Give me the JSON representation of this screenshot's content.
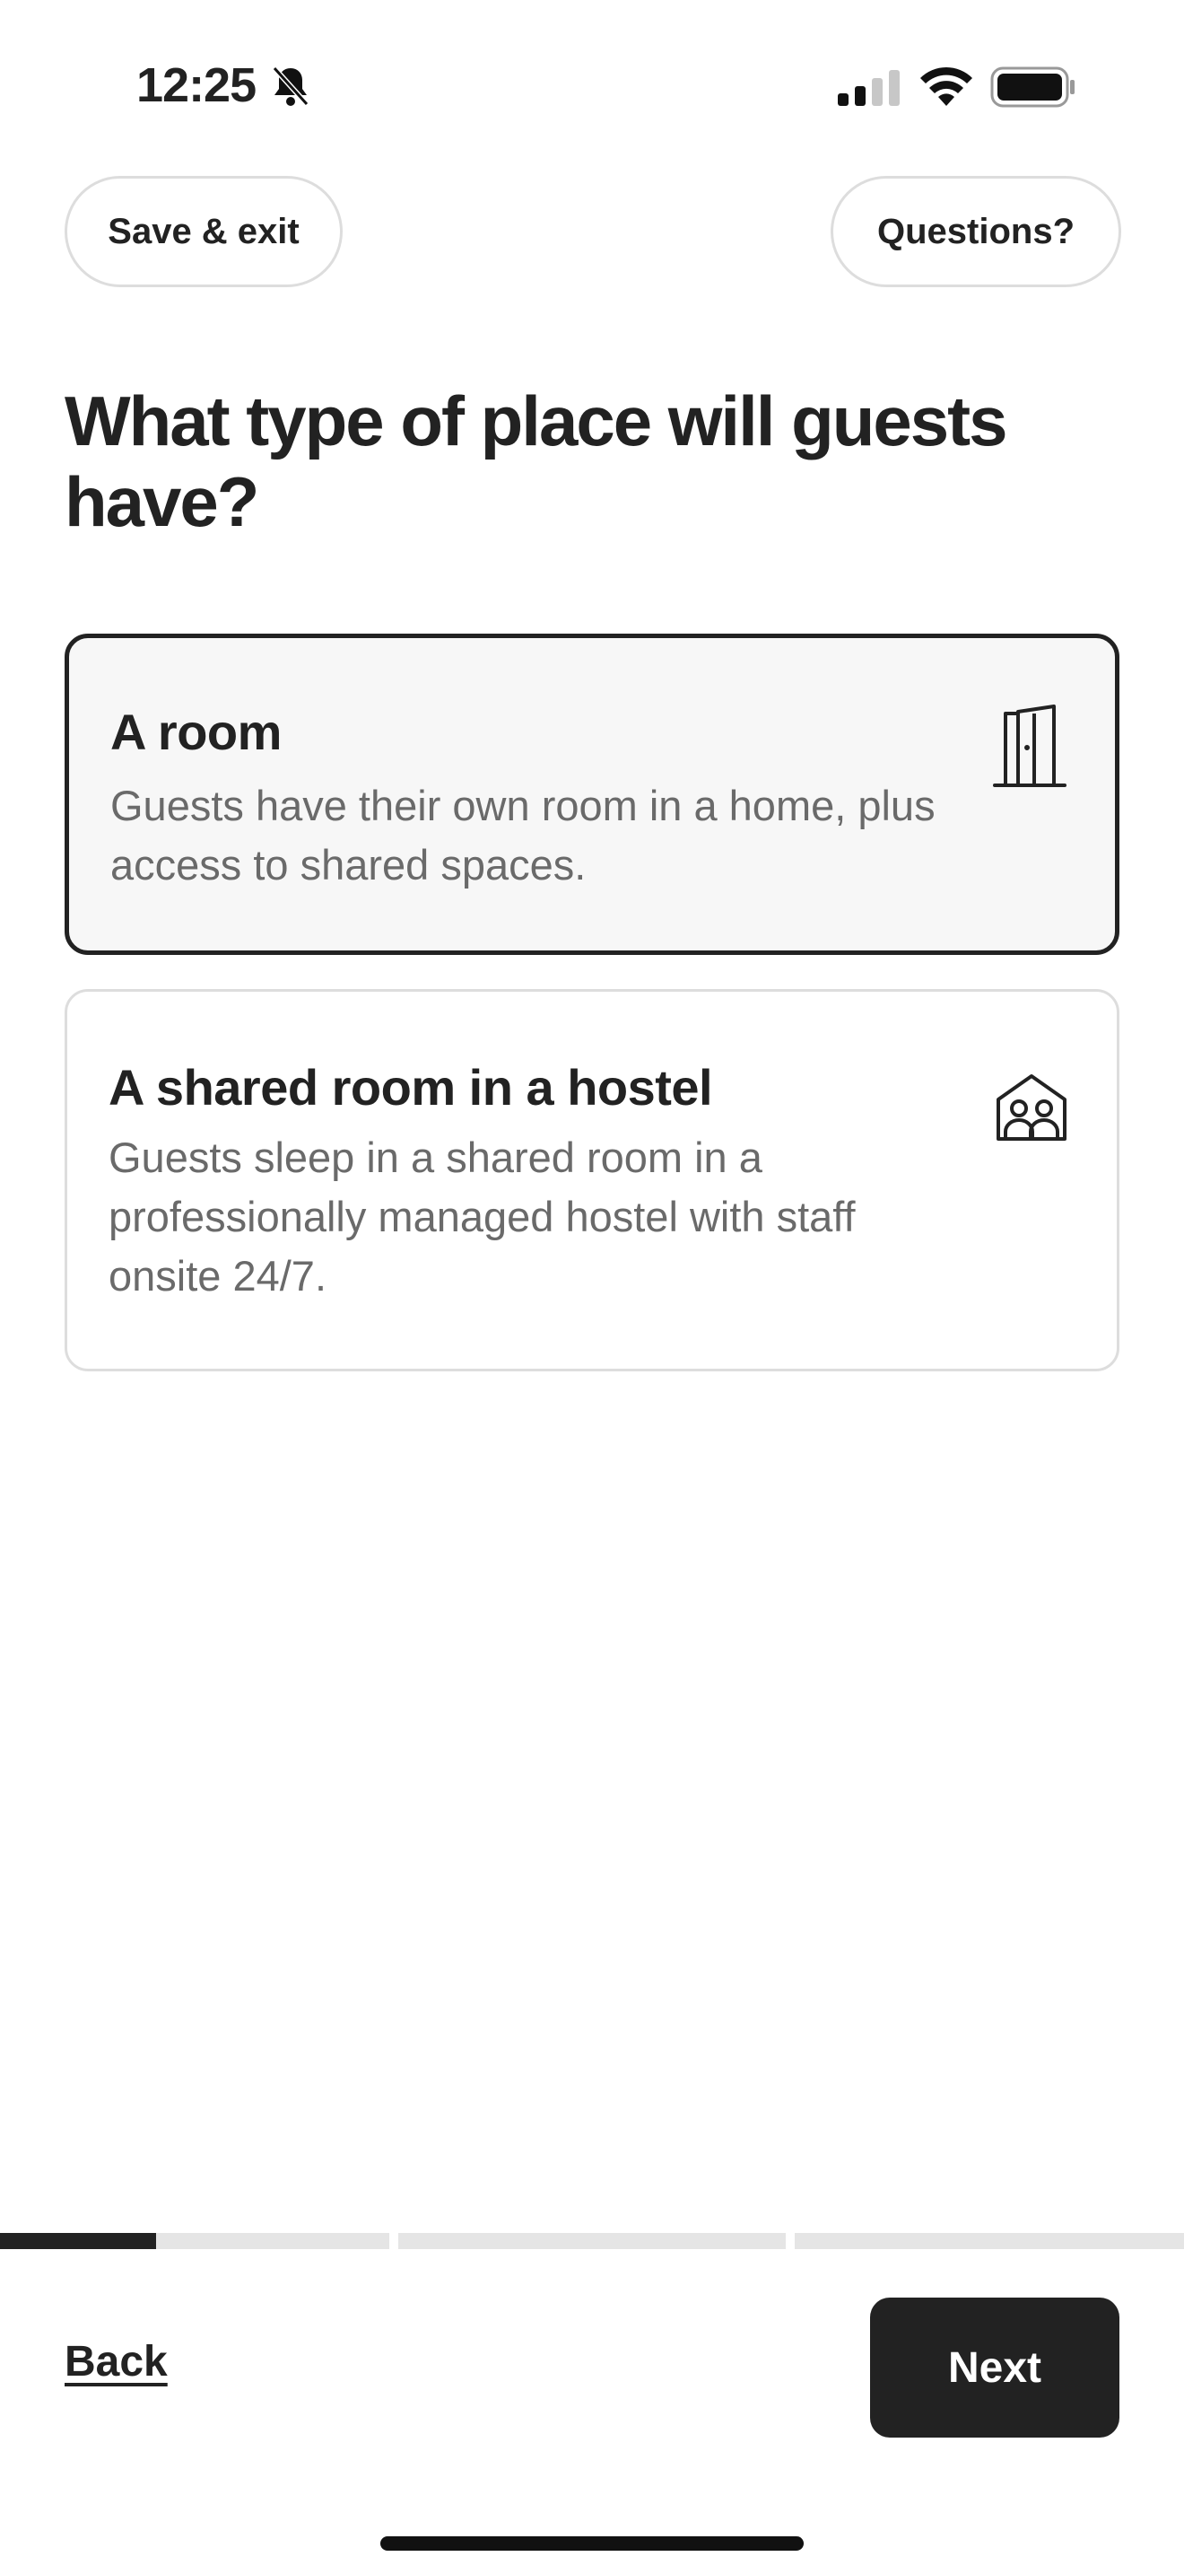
{
  "status_bar": {
    "time": "12:25",
    "icons": [
      "bell-off-icon",
      "cellular-signal-icon",
      "wifi-icon",
      "battery-icon"
    ]
  },
  "header": {
    "save_exit_label": "Save & exit",
    "questions_label": "Questions?"
  },
  "page": {
    "title": "What type of place will guests have?"
  },
  "options": [
    {
      "title": "A room",
      "description": "Guests have their own room in a home, plus access to shared spaces.",
      "icon": "door-icon",
      "selected": true
    },
    {
      "title": "A shared room in a hostel",
      "description": "Guests sleep in a shared room in a professionally managed hostel with staff onsite 24/7.",
      "icon": "shared-room-icon",
      "selected": false
    }
  ],
  "progress": {
    "steps": 3,
    "current_step": 1,
    "current_step_fraction": 0.4
  },
  "footer": {
    "back_label": "Back",
    "next_label": "Next"
  },
  "colors": {
    "text_primary": "#222222",
    "text_secondary": "#6a6a6a",
    "border": "#dddddd",
    "selected_card_bg": "#f7f7f7",
    "progress_track": "#e5e5e5"
  }
}
